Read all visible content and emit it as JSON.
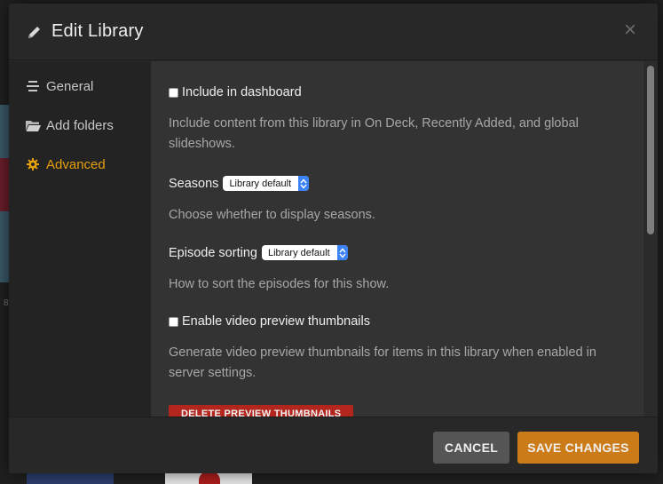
{
  "modal": {
    "title": "Edit Library",
    "title_icon": "pencil-icon",
    "close_glyph": "×"
  },
  "sidebar": {
    "items": [
      {
        "label": "General",
        "icon": "list-lines-icon",
        "active": false
      },
      {
        "label": "Add folders",
        "icon": "folder-icon",
        "active": false
      },
      {
        "label": "Advanced",
        "icon": "gear-icon",
        "active": true
      }
    ],
    "active_color": "#e5a00d"
  },
  "content": {
    "include_dashboard": {
      "label": "Include in dashboard",
      "checked": false,
      "help": "Include content from this library in On Deck, Recently Added, and global slideshows."
    },
    "seasons": {
      "label": "Seasons",
      "value": "Library default",
      "help": "Choose whether to display seasons."
    },
    "episode_sorting": {
      "label": "Episode sorting",
      "value": "Library default",
      "help": "How to sort the episodes for this show."
    },
    "video_preview": {
      "label": "Enable video preview thumbnails",
      "checked": false,
      "help": "Generate video preview thumbnails for items in this library when enabled in server settings."
    },
    "delete_thumbnails_label": "DELETE PREVIEW THUMBNAILS"
  },
  "footer": {
    "cancel_label": "CANCEL",
    "save_label": "SAVE CHANGES"
  },
  "background": {
    "fragment_text": "8"
  },
  "colors": {
    "accent": "#cc7b19",
    "danger": "#b3261e",
    "select_arrow": "#3b82f6"
  }
}
